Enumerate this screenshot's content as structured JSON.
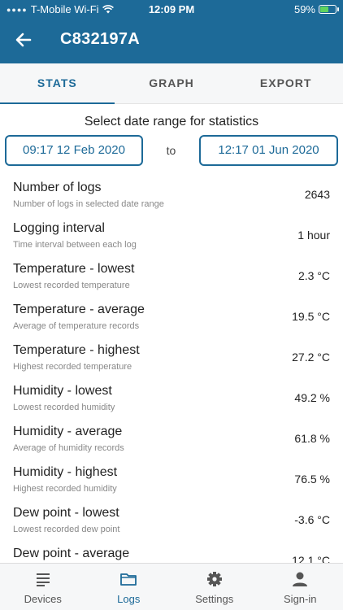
{
  "status": {
    "carrier": "T-Mobile Wi-Fi",
    "time": "12:09 PM",
    "battery": "59%",
    "battery_level": 0.59
  },
  "header": {
    "title": "C832197A"
  },
  "tabs": [
    {
      "label": "STATS"
    },
    {
      "label": "GRAPH"
    },
    {
      "label": "EXPORT"
    }
  ],
  "range": {
    "title": "Select date range for statistics",
    "from": "09:17 12 Feb 2020",
    "to_label": "to",
    "to": "12:17 01 Jun 2020"
  },
  "stats": [
    {
      "name": "Number of logs",
      "desc": "Number of logs in selected date range",
      "value": "2643"
    },
    {
      "name": "Logging interval",
      "desc": "Time interval between each log",
      "value": "1 hour"
    },
    {
      "name": "Temperature - lowest",
      "desc": "Lowest recorded temperature",
      "value": "2.3 °C"
    },
    {
      "name": "Temperature - average",
      "desc": "Average of temperature records",
      "value": "19.5 °C"
    },
    {
      "name": "Temperature - highest",
      "desc": "Highest recorded temperature",
      "value": "27.2 °C"
    },
    {
      "name": "Humidity - lowest",
      "desc": "Lowest recorded humidity",
      "value": "49.2 %"
    },
    {
      "name": "Humidity - average",
      "desc": "Average of humidity records",
      "value": "61.8 %"
    },
    {
      "name": "Humidity - highest",
      "desc": "Highest recorded humidity",
      "value": "76.5 %"
    },
    {
      "name": "Dew point - lowest",
      "desc": "Lowest recorded dew point",
      "value": "-3.6 °C"
    },
    {
      "name": "Dew point - average",
      "desc": "",
      "value": "12.1 °C"
    }
  ],
  "nav": [
    {
      "label": "Devices",
      "icon": "list-icon"
    },
    {
      "label": "Logs",
      "icon": "folder-icon"
    },
    {
      "label": "Settings",
      "icon": "gear-icon"
    },
    {
      "label": "Sign-in",
      "icon": "person-icon"
    }
  ],
  "colors": {
    "primary": "#1d6a98",
    "battery": "#5fd35f"
  }
}
